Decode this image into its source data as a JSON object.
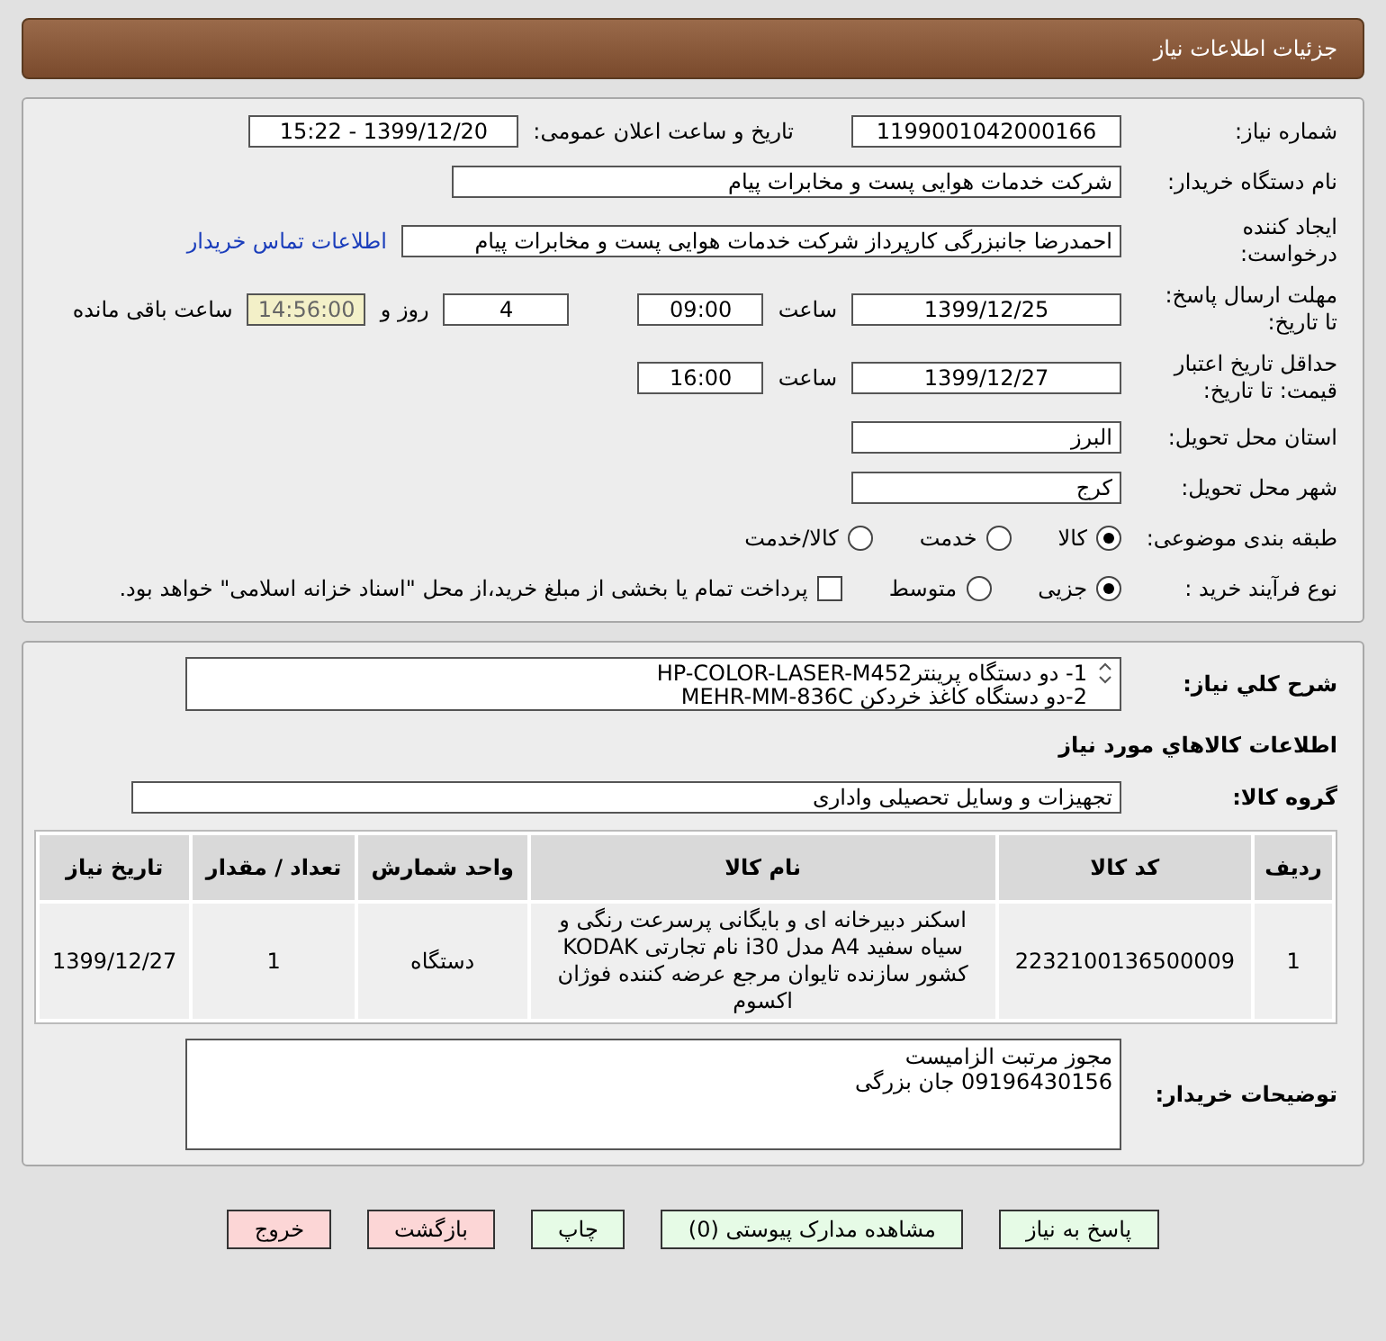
{
  "header": {
    "title": "جزئیات اطلاعات نیاز"
  },
  "details": {
    "need_number": {
      "label": "شماره نیاز:",
      "value": "1199001042000166"
    },
    "announce": {
      "label": "تاریخ و ساعت اعلان عمومی:",
      "value": "1399/12/20 - 15:22"
    },
    "buyer": {
      "label": "نام دستگاه خریدار:",
      "value": "شرکت خدمات هوایی پست و مخابرات پیام"
    },
    "creator": {
      "label": "ایجاد کننده\nدرخواست:",
      "value": "احمدرضا جانبزرگی کارپرداز شرکت خدمات هوایی پست و مخابرات پیام",
      "link": "اطلاعات تماس خریدار"
    },
    "deadline": {
      "label": "مهلت ارسال پاسخ:\nتا تاریخ:",
      "date": "1399/12/25",
      "time_label": "ساعت",
      "time": "09:00",
      "days": "4",
      "days_label": "روز و",
      "remaining": "14:56:00",
      "remaining_label": "ساعت باقی مانده"
    },
    "validity": {
      "label": "حداقل تاریخ اعتبار\nقیمت: تا تاریخ:",
      "date": "1399/12/27",
      "time_label": "ساعت",
      "time": "16:00"
    },
    "province": {
      "label": "استان محل تحویل:",
      "value": "البرز"
    },
    "city": {
      "label": "شهر محل تحویل:",
      "value": "کرج"
    },
    "category": {
      "label": "طبقه بندی موضوعی:",
      "options": [
        {
          "label": "کالا",
          "selected": true
        },
        {
          "label": "خدمت",
          "selected": false
        },
        {
          "label": "کالا/خدمت",
          "selected": false
        }
      ]
    },
    "process": {
      "label": "نوع فرآیند خرید :",
      "options": [
        {
          "label": "جزیی",
          "selected": true
        },
        {
          "label": "متوسط",
          "selected": false
        }
      ],
      "payment": {
        "checked": false,
        "text": "پرداخت تمام یا بخشی از مبلغ خرید،از محل \"اسناد خزانه اسلامی\" خواهد بود."
      }
    }
  },
  "needs": {
    "description": {
      "label": "شرح کلي نیاز:",
      "lines": [
        "1- دو دستگاه پرینترHP-COLOR-LASER-M452",
        "2-دو دستگاه کاغذ خردکن MEHR-MM-836C"
      ]
    },
    "section_title": "اطلاعات کالاهاي مورد نیاز",
    "group": {
      "label": "گروه کالا:",
      "value": "تجهیزات و وسایل تحصیلی واداری"
    },
    "table": {
      "columns": [
        "ردیف",
        "کد کالا",
        "نام کالا",
        "واحد شمارش",
        "تعداد / مقدار",
        "تاریخ نیاز"
      ],
      "rows": [
        [
          "1",
          "2232100136500009",
          "اسکنر دبیرخانه ای و بایگانی پرسرعت رنگی و سیاه سفید A4 مدل i30 نام تجارتی KODAK کشور سازنده تایوان مرجع عرضه کننده فوژان اکسوم",
          "دستگاه",
          "1",
          "1399/12/27"
        ]
      ]
    },
    "notes": {
      "label": "توضیحات خریدار:",
      "lines": [
        "مجوز مرتبت الزامیست",
        "09196430156 جان بزرگی"
      ]
    }
  },
  "buttons": [
    {
      "label": "پاسخ به نیاز",
      "kind": "normal"
    },
    {
      "label": "مشاهده مدارک پیوستی (0)",
      "kind": "normal"
    },
    {
      "label": "چاپ",
      "kind": "normal"
    },
    {
      "label": "بازگشت",
      "kind": "warn"
    },
    {
      "label": "خروج",
      "kind": "warn"
    }
  ]
}
